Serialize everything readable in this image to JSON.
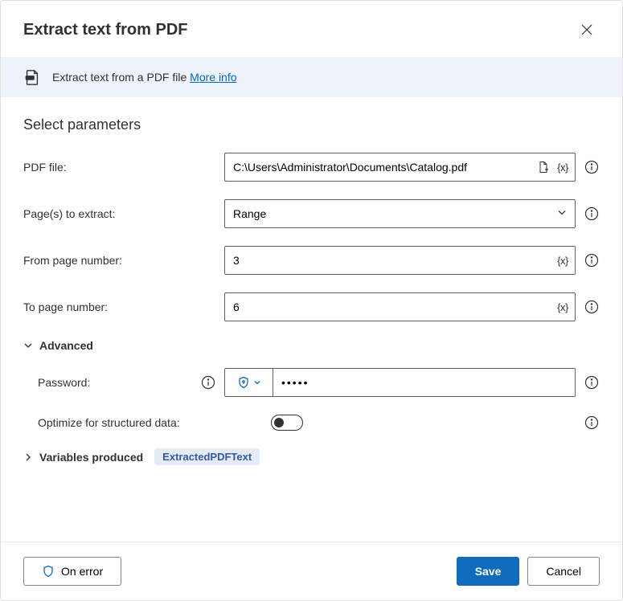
{
  "header": {
    "title": "Extract text from PDF"
  },
  "banner": {
    "text": "Extract text from a PDF file",
    "link": "More info"
  },
  "section": {
    "title": "Select parameters"
  },
  "fields": {
    "pdf_file": {
      "label": "PDF file:",
      "value": "C:\\Users\\Administrator\\Documents\\Catalog.pdf"
    },
    "pages": {
      "label": "Page(s) to extract:",
      "value": "Range"
    },
    "from_page": {
      "label": "From page number:",
      "value": "3"
    },
    "to_page": {
      "label": "To page number:",
      "value": "6"
    },
    "password": {
      "label": "Password:",
      "value": "•••••"
    },
    "optimize": {
      "label": "Optimize for structured data:"
    }
  },
  "advanced": {
    "label": "Advanced"
  },
  "variables": {
    "label": "Variables produced",
    "chip": "ExtractedPDFText"
  },
  "footer": {
    "on_error": "On error",
    "save": "Save",
    "cancel": "Cancel"
  }
}
